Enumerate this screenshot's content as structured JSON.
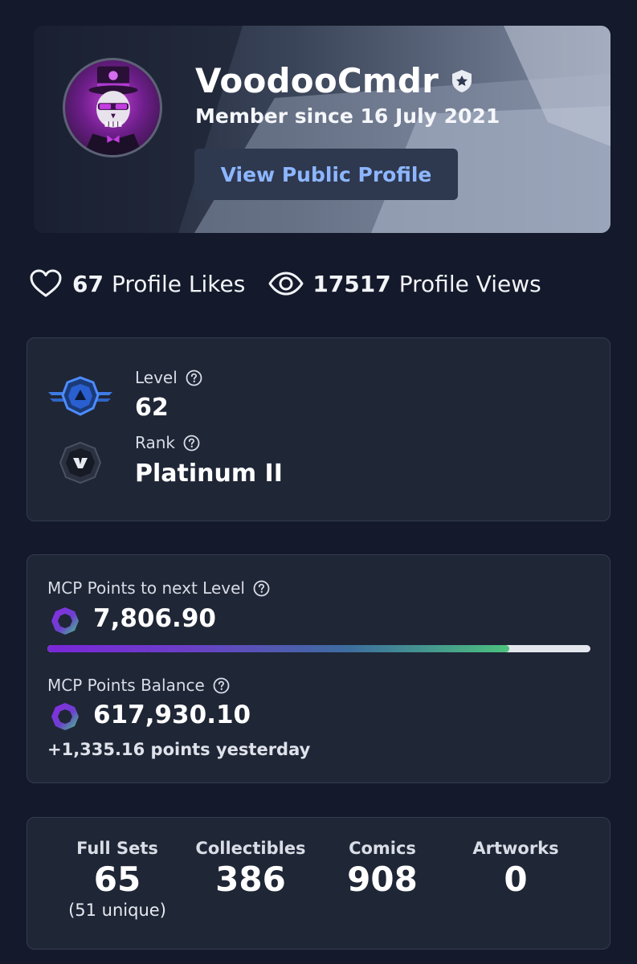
{
  "profile": {
    "username": "VoodooCmdr",
    "member_since": "Member since 16 July 2021",
    "view_public_profile": "View Public Profile",
    "avatar_icon": "skull-top-hat-avatar",
    "verified_icon": "shield-star-icon"
  },
  "stats": {
    "likes_count": "67",
    "likes_label": "Profile Likes",
    "views_count": "17517",
    "views_label": "Profile Views"
  },
  "level_card": {
    "level_label": "Level",
    "level_value": "62",
    "rank_label": "Rank",
    "rank_value": "Platinum II"
  },
  "points_card": {
    "next_level_label": "MCP Points to next Level",
    "next_level_value": "7,806.90",
    "progress_fraction": 0.85,
    "balance_label": "MCP Points Balance",
    "balance_value": "617,930.10",
    "yesterday": "+1,335.16 points yesterday"
  },
  "collection": {
    "columns": [
      {
        "label": "Full Sets",
        "value": "65",
        "sub": "(51 unique)"
      },
      {
        "label": "Collectibles",
        "value": "386",
        "sub": ""
      },
      {
        "label": "Comics",
        "value": "908",
        "sub": ""
      },
      {
        "label": "Artworks",
        "value": "0",
        "sub": ""
      }
    ]
  },
  "colors": {
    "background": "#141a2b",
    "card": "#1f2636",
    "button_text": "#8db6ff",
    "progress_start": "#7a27d8",
    "progress_end": "#4cc27d"
  }
}
